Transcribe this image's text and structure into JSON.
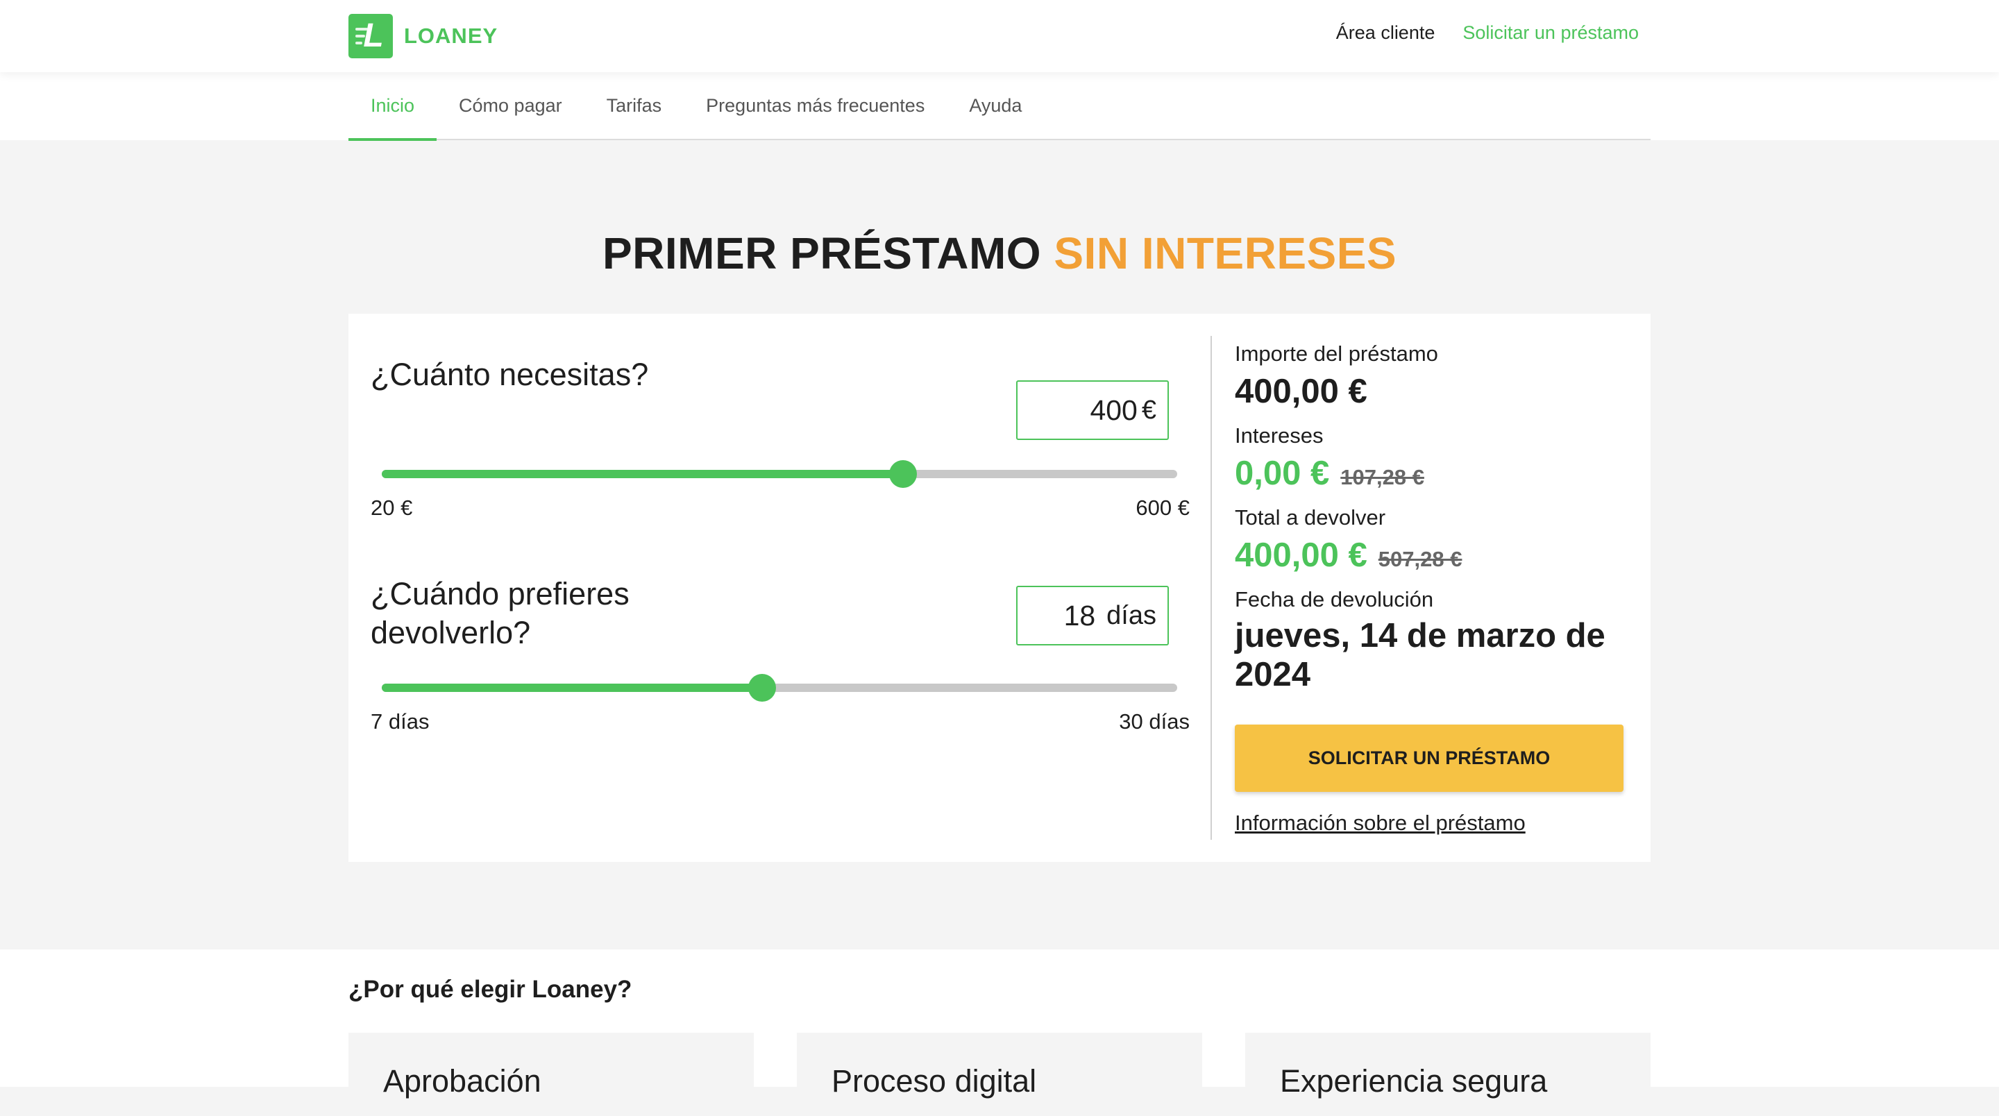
{
  "header": {
    "logo_letter": "L",
    "logo_text": "LOANEY",
    "client_area": "Área cliente",
    "request_loan": "Solicitar un préstamo"
  },
  "nav": {
    "tabs": [
      {
        "label": "Inicio",
        "active": true
      },
      {
        "label": "Cómo pagar",
        "active": false
      },
      {
        "label": "Tarifas",
        "active": false
      },
      {
        "label": "Preguntas más frecuentes",
        "active": false
      },
      {
        "label": "Ayuda",
        "active": false
      }
    ]
  },
  "hero": {
    "title_main": "PRIMER PRÉSTAMO",
    "title_accent": "SIN INTERESES"
  },
  "calculator": {
    "amount": {
      "question": "¿Cuánto necesitas?",
      "value": "400",
      "unit": "€",
      "min_label": "20 €",
      "max_label": "600 €",
      "min": 20,
      "max": 600,
      "current": 400
    },
    "term": {
      "question": "¿Cuándo prefieres devolverlo?",
      "value": "18",
      "unit": "días",
      "min_label": "7 días",
      "max_label": "30 días",
      "min": 7,
      "max": 30,
      "current": 18
    }
  },
  "summary": {
    "amount_label": "Importe del préstamo",
    "amount_value": "400,00 €",
    "interest_label": "Intereses",
    "interest_value": "0,00 €",
    "interest_old": "107,28 €",
    "total_label": "Total a devolver",
    "total_value": "400,00 €",
    "total_old": "507,28 €",
    "date_label": "Fecha de devolución",
    "date_value": "jueves, 14 de marzo de 2024",
    "cta_label": "SOLICITAR UN PRÉSTAMO",
    "info_link": "Información sobre el préstamo"
  },
  "why": {
    "title": "¿Por qué elegir Loaney?",
    "cards": [
      {
        "title": "Aprobación"
      },
      {
        "title": "Proceso digital"
      },
      {
        "title": "Experiencia segura"
      }
    ]
  },
  "colors": {
    "brand_green": "#4cc35a",
    "accent_orange": "#f2a036",
    "cta_yellow": "#f6c244"
  }
}
